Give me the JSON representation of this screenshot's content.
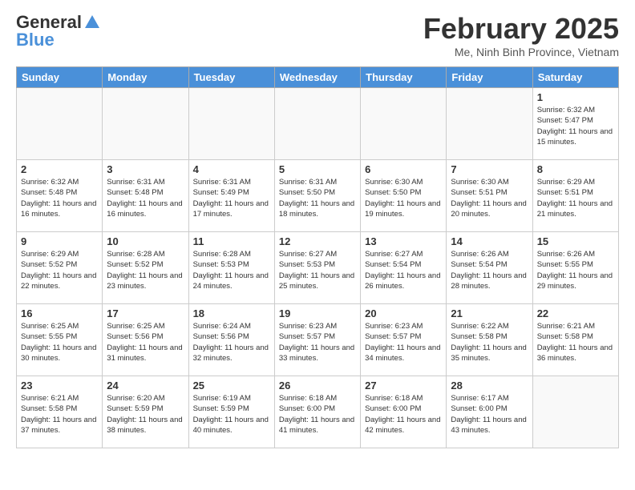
{
  "header": {
    "logo_general": "General",
    "logo_blue": "Blue",
    "month_title": "February 2025",
    "location": "Me, Ninh Binh Province, Vietnam"
  },
  "weekdays": [
    "Sunday",
    "Monday",
    "Tuesday",
    "Wednesday",
    "Thursday",
    "Friday",
    "Saturday"
  ],
  "weeks": [
    [
      {
        "day": "",
        "info": ""
      },
      {
        "day": "",
        "info": ""
      },
      {
        "day": "",
        "info": ""
      },
      {
        "day": "",
        "info": ""
      },
      {
        "day": "",
        "info": ""
      },
      {
        "day": "",
        "info": ""
      },
      {
        "day": "1",
        "info": "Sunrise: 6:32 AM\nSunset: 5:47 PM\nDaylight: 11 hours and 15 minutes."
      }
    ],
    [
      {
        "day": "2",
        "info": "Sunrise: 6:32 AM\nSunset: 5:48 PM\nDaylight: 11 hours and 16 minutes."
      },
      {
        "day": "3",
        "info": "Sunrise: 6:31 AM\nSunset: 5:48 PM\nDaylight: 11 hours and 16 minutes."
      },
      {
        "day": "4",
        "info": "Sunrise: 6:31 AM\nSunset: 5:49 PM\nDaylight: 11 hours and 17 minutes."
      },
      {
        "day": "5",
        "info": "Sunrise: 6:31 AM\nSunset: 5:50 PM\nDaylight: 11 hours and 18 minutes."
      },
      {
        "day": "6",
        "info": "Sunrise: 6:30 AM\nSunset: 5:50 PM\nDaylight: 11 hours and 19 minutes."
      },
      {
        "day": "7",
        "info": "Sunrise: 6:30 AM\nSunset: 5:51 PM\nDaylight: 11 hours and 20 minutes."
      },
      {
        "day": "8",
        "info": "Sunrise: 6:29 AM\nSunset: 5:51 PM\nDaylight: 11 hours and 21 minutes."
      }
    ],
    [
      {
        "day": "9",
        "info": "Sunrise: 6:29 AM\nSunset: 5:52 PM\nDaylight: 11 hours and 22 minutes."
      },
      {
        "day": "10",
        "info": "Sunrise: 6:28 AM\nSunset: 5:52 PM\nDaylight: 11 hours and 23 minutes."
      },
      {
        "day": "11",
        "info": "Sunrise: 6:28 AM\nSunset: 5:53 PM\nDaylight: 11 hours and 24 minutes."
      },
      {
        "day": "12",
        "info": "Sunrise: 6:27 AM\nSunset: 5:53 PM\nDaylight: 11 hours and 25 minutes."
      },
      {
        "day": "13",
        "info": "Sunrise: 6:27 AM\nSunset: 5:54 PM\nDaylight: 11 hours and 26 minutes."
      },
      {
        "day": "14",
        "info": "Sunrise: 6:26 AM\nSunset: 5:54 PM\nDaylight: 11 hours and 28 minutes."
      },
      {
        "day": "15",
        "info": "Sunrise: 6:26 AM\nSunset: 5:55 PM\nDaylight: 11 hours and 29 minutes."
      }
    ],
    [
      {
        "day": "16",
        "info": "Sunrise: 6:25 AM\nSunset: 5:55 PM\nDaylight: 11 hours and 30 minutes."
      },
      {
        "day": "17",
        "info": "Sunrise: 6:25 AM\nSunset: 5:56 PM\nDaylight: 11 hours and 31 minutes."
      },
      {
        "day": "18",
        "info": "Sunrise: 6:24 AM\nSunset: 5:56 PM\nDaylight: 11 hours and 32 minutes."
      },
      {
        "day": "19",
        "info": "Sunrise: 6:23 AM\nSunset: 5:57 PM\nDaylight: 11 hours and 33 minutes."
      },
      {
        "day": "20",
        "info": "Sunrise: 6:23 AM\nSunset: 5:57 PM\nDaylight: 11 hours and 34 minutes."
      },
      {
        "day": "21",
        "info": "Sunrise: 6:22 AM\nSunset: 5:58 PM\nDaylight: 11 hours and 35 minutes."
      },
      {
        "day": "22",
        "info": "Sunrise: 6:21 AM\nSunset: 5:58 PM\nDaylight: 11 hours and 36 minutes."
      }
    ],
    [
      {
        "day": "23",
        "info": "Sunrise: 6:21 AM\nSunset: 5:58 PM\nDaylight: 11 hours and 37 minutes."
      },
      {
        "day": "24",
        "info": "Sunrise: 6:20 AM\nSunset: 5:59 PM\nDaylight: 11 hours and 38 minutes."
      },
      {
        "day": "25",
        "info": "Sunrise: 6:19 AM\nSunset: 5:59 PM\nDaylight: 11 hours and 40 minutes."
      },
      {
        "day": "26",
        "info": "Sunrise: 6:18 AM\nSunset: 6:00 PM\nDaylight: 11 hours and 41 minutes."
      },
      {
        "day": "27",
        "info": "Sunrise: 6:18 AM\nSunset: 6:00 PM\nDaylight: 11 hours and 42 minutes."
      },
      {
        "day": "28",
        "info": "Sunrise: 6:17 AM\nSunset: 6:00 PM\nDaylight: 11 hours and 43 minutes."
      },
      {
        "day": "",
        "info": ""
      }
    ]
  ]
}
